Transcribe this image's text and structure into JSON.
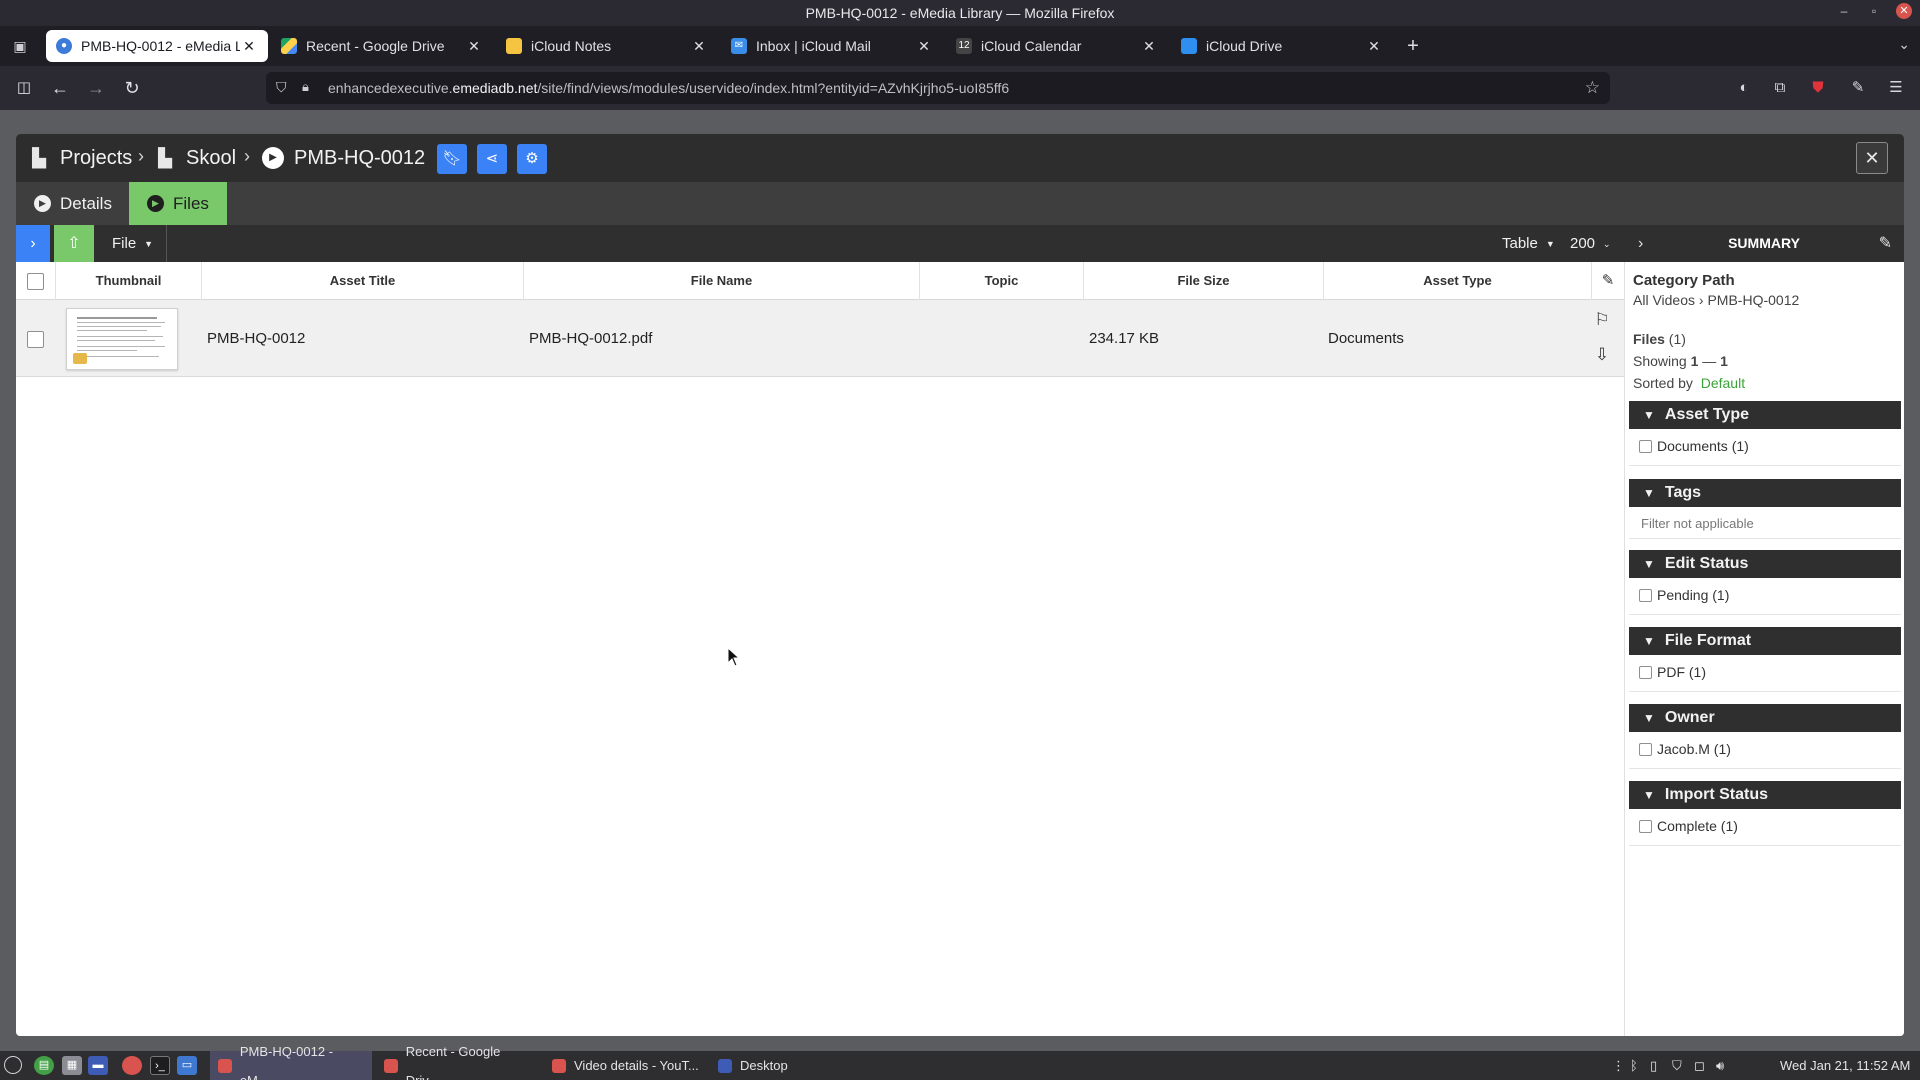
{
  "window": {
    "title": "PMB-HQ-0012 - eMedia Library — Mozilla Firefox"
  },
  "browser_tabs": [
    {
      "label": "PMB-HQ-0012 - eMedia Libr",
      "icon": "emedia-favicon",
      "active": true
    },
    {
      "label": "Recent - Google Drive",
      "icon": "google-drive-favicon",
      "active": false
    },
    {
      "label": "iCloud Notes",
      "icon": "icloud-notes-favicon",
      "active": false
    },
    {
      "label": "Inbox | iCloud Mail",
      "icon": "icloud-mail-favicon",
      "active": false
    },
    {
      "label": "iCloud Calendar",
      "icon": "icloud-calendar-favicon",
      "active": false
    },
    {
      "label": "iCloud Drive",
      "icon": "icloud-drive-favicon",
      "active": false
    }
  ],
  "calendar_favicon_day": "12",
  "address": {
    "prefix": "enhancedexecutive.",
    "domain": "emediadb.net",
    "path": "/site/find/views/modules/uservideo/index.html?entityid=AZvhKjrjho5-uoI85ff6"
  },
  "app": {
    "breadcrumb": [
      {
        "label": "Projects",
        "icon": "building-icon"
      },
      {
        "label": "Skool",
        "icon": "building-icon"
      },
      {
        "label": "PMB-HQ-0012",
        "icon": "play-circle-icon"
      }
    ],
    "header_buttons": [
      "bookmark-icon",
      "share-icon",
      "gear-icon"
    ],
    "close_symbol": "✕",
    "tabs": [
      {
        "label": "Details",
        "active": false
      },
      {
        "label": "Files",
        "active": true
      }
    ],
    "toolbar": {
      "file_menu": "File",
      "view_mode": "Table",
      "page_size": "200"
    },
    "summary_title": "SUMMARY"
  },
  "table": {
    "columns": [
      "Thumbnail",
      "Asset Title",
      "File Name",
      "Topic",
      "File Size",
      "Asset Type"
    ],
    "rows": [
      {
        "asset_title": "PMB-HQ-0012",
        "file_name": "PMB-HQ-0012.pdf",
        "topic": "",
        "file_size": "234.17 KB",
        "asset_type": "Documents"
      }
    ]
  },
  "summary": {
    "category_path_label": "Category Path",
    "category_path_root": "All Videos",
    "category_path_sep": " › ",
    "category_path_leaf": "PMB-HQ-0012",
    "files_label": "Files",
    "files_count": "(1)",
    "showing_label": "Showing",
    "showing_from": "1",
    "showing_dash": " — ",
    "showing_to": "1",
    "sorted_label": "Sorted by",
    "sorted_value": "Default",
    "facets": [
      {
        "title": "Asset Type",
        "options": [
          "Documents (1)"
        ]
      },
      {
        "title": "Tags",
        "note": "Filter not applicable"
      },
      {
        "title": "Edit Status",
        "options": [
          "Pending (1)"
        ]
      },
      {
        "title": "File Format",
        "options": [
          "PDF (1)"
        ]
      },
      {
        "title": "Owner",
        "options": [
          "Jacob.M (1)"
        ]
      },
      {
        "title": "Import Status",
        "options": [
          "Complete (1)"
        ]
      }
    ]
  },
  "taskbar": {
    "tasks": [
      {
        "label": "PMB-HQ-0012 - eM...",
        "active": true
      },
      {
        "label": "Recent - Google Driv...",
        "active": false
      },
      {
        "label": "Video details - YouT...",
        "active": false
      },
      {
        "label": "Desktop",
        "active": false
      }
    ],
    "clock": "Wed Jan 21, 11:52 AM"
  },
  "colors": {
    "accent_blue": "#3b82f6",
    "accent_green": "#79c96b",
    "header_dark": "#2d2d2d",
    "link_green": "#3aa33a"
  }
}
